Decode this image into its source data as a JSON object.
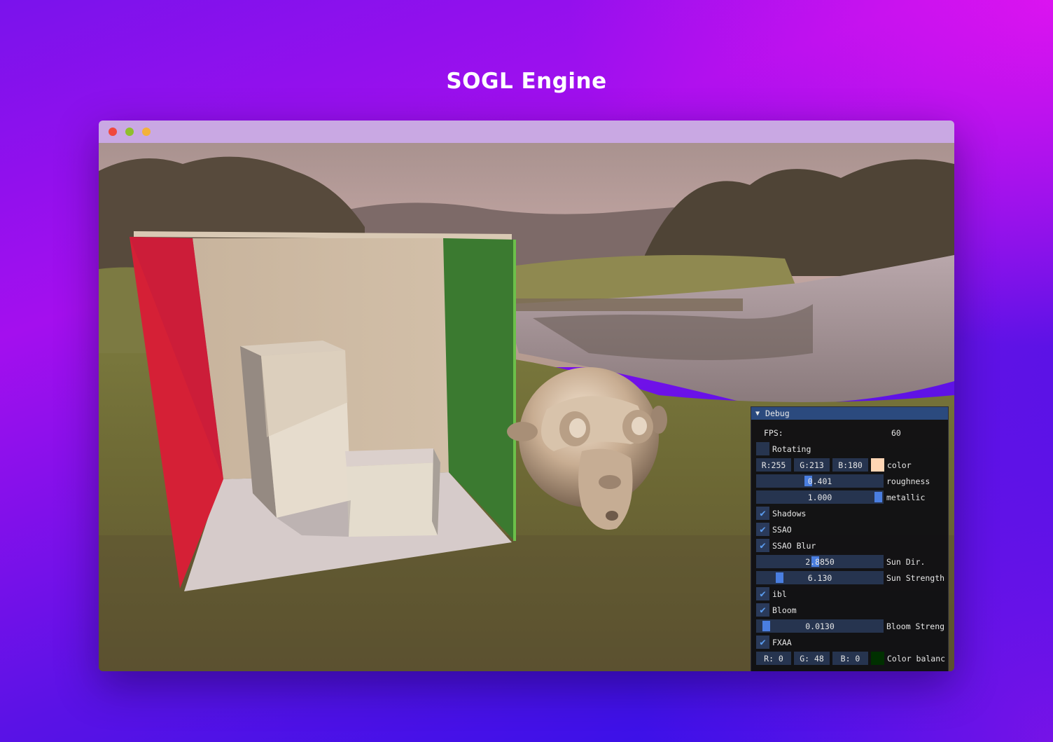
{
  "page": {
    "title": "SOGL Engine"
  },
  "window": {
    "controls": {
      "close_color": "#f0483e",
      "minimize_color": "#8fbf2e",
      "maximize_color": "#f3b23a"
    },
    "titlebar_color": "#c9a8e3"
  },
  "debug": {
    "title": "Debug",
    "fps_label": "FPS:",
    "fps_value": "60",
    "rotating": {
      "label": "Rotating",
      "checked": false
    },
    "color": {
      "r": "R:255",
      "g": "G:213",
      "b": "B:180",
      "label": "color",
      "swatch": "#ffd5b4"
    },
    "roughness": {
      "value": "0.401",
      "fraction": 0.401,
      "label": "roughness"
    },
    "metallic": {
      "value": "1.000",
      "fraction": 1.0,
      "label": "metallic"
    },
    "shadows": {
      "label": "Shadows",
      "checked": true
    },
    "ssao": {
      "label": "SSAO",
      "checked": true
    },
    "ssao_blur": {
      "label": "SSAO Blur",
      "checked": true
    },
    "sun_dir": {
      "value": "2.8850",
      "label": "Sun Dir."
    },
    "sun_strength": {
      "value": "6.130",
      "label": "Sun Strength"
    },
    "ibl": {
      "label": "ibl",
      "checked": true
    },
    "bloom": {
      "label": "Bloom",
      "checked": true
    },
    "bloom_strength": {
      "value": "0.0130",
      "label": "Bloom Streng"
    },
    "fxaa": {
      "label": "FXAA",
      "checked": true
    },
    "color_balance": {
      "r": "R:  0",
      "g": "G: 48",
      "b": "B:  0",
      "label": "Color balanc",
      "swatch": "#003000"
    }
  }
}
